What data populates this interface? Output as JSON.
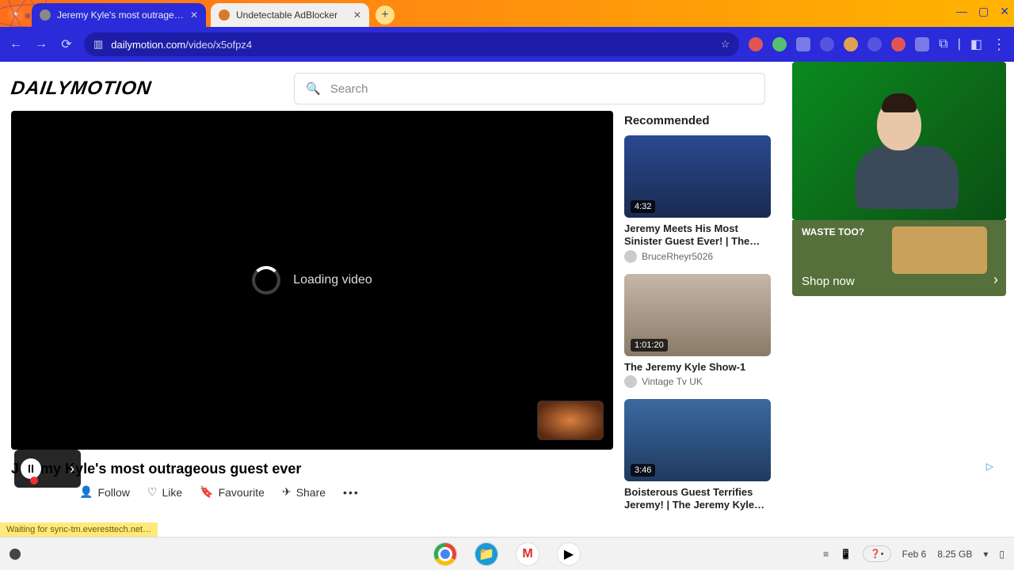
{
  "browser": {
    "tabs": [
      {
        "title": "Jeremy Kyle's most outrageo…"
      },
      {
        "title": "Undetectable AdBlocker"
      }
    ],
    "url_host": "dailymotion.com",
    "url_path": "/video/x5ofpz4"
  },
  "site": {
    "logo": "DAILYMOTION",
    "search_placeholder": "Search"
  },
  "player": {
    "loading_text": "Loading video"
  },
  "video": {
    "title": "Jeremy Kyle's most outrageous guest ever",
    "actions": {
      "follow": "Follow",
      "like": "Like",
      "favourite": "Favourite",
      "share": "Share"
    }
  },
  "recommended": {
    "heading": "Recommended",
    "items": [
      {
        "duration": "4:32",
        "title": "Jeremy Meets His Most Sinister Guest Ever! | The…",
        "channel": "BruceRheyr5026"
      },
      {
        "duration": "1:01:20",
        "title": "The Jeremy Kyle Show-1",
        "channel": "Vintage Tv UK"
      },
      {
        "duration": "3:46",
        "title": "Boisterous Guest Terrifies Jeremy! | The Jeremy Kyle…",
        "channel": ""
      }
    ]
  },
  "ad": {
    "tagline": "WASTE TOO?",
    "cta": "Shop now"
  },
  "status_bar": "Waiting for sync-tm.everesttech.net…",
  "shelf": {
    "date": "Feb 6",
    "mem": "8.25 GB"
  }
}
